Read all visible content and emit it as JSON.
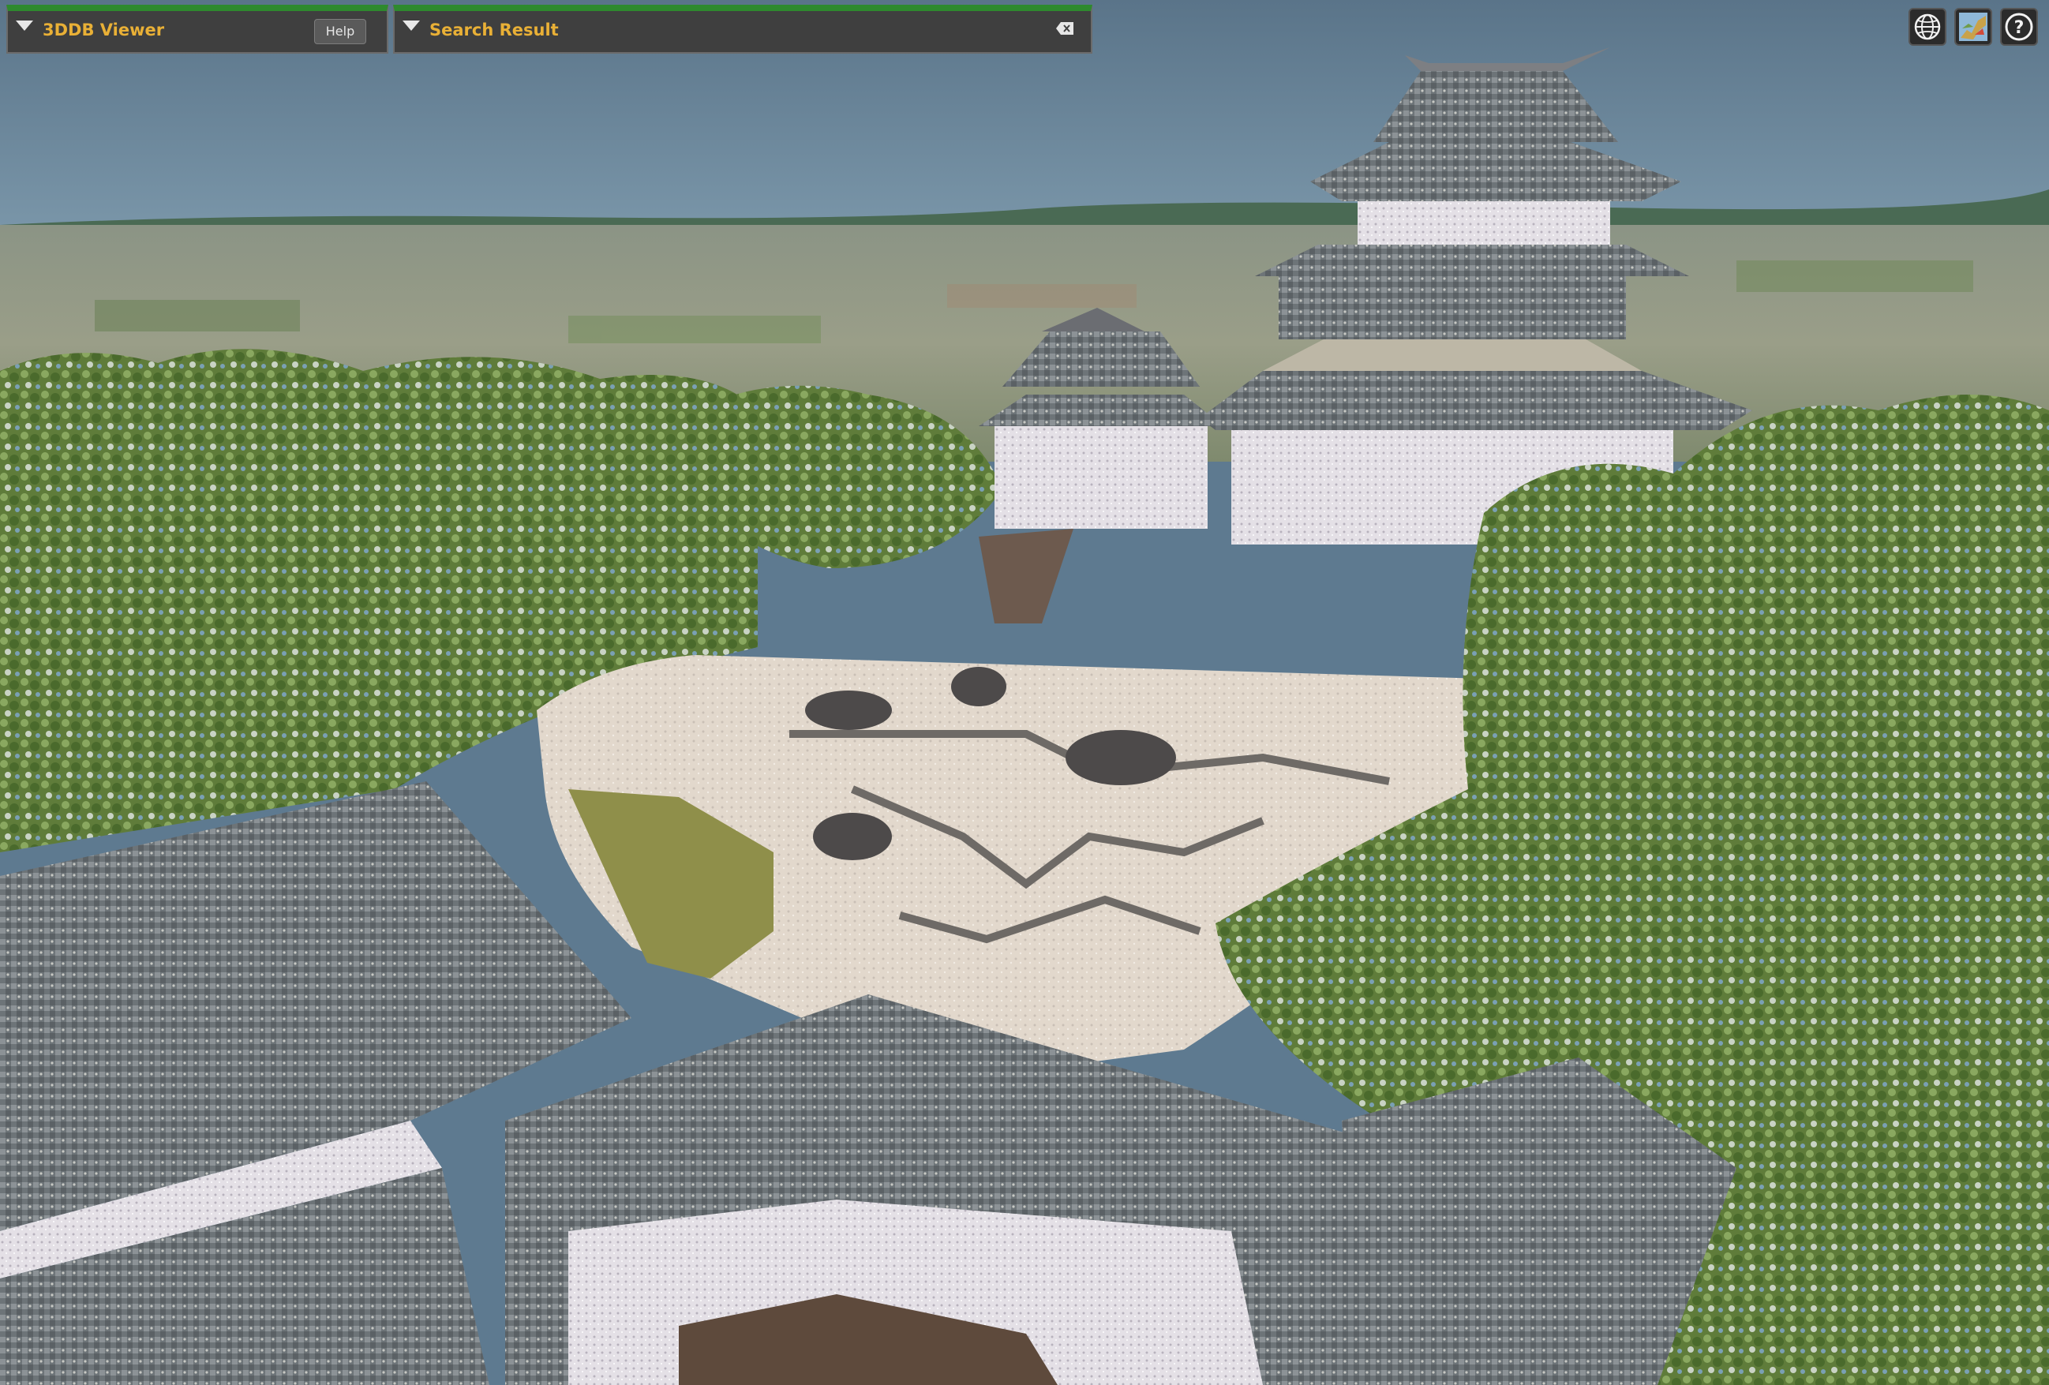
{
  "viewer_panel": {
    "title": "3DDB Viewer",
    "help_label": "Help"
  },
  "search_panel": {
    "title": "Search Result"
  },
  "toolbar": {
    "globe_icon": "globe-icon",
    "map_icon": "map-layer-icon",
    "help_icon": "question-icon",
    "help_glyph": "?"
  },
  "colors": {
    "panel_bg": "#3f3f3f",
    "panel_accent": "#2e8a2e",
    "title": "#e9b036",
    "sky": "#5e7a90"
  }
}
